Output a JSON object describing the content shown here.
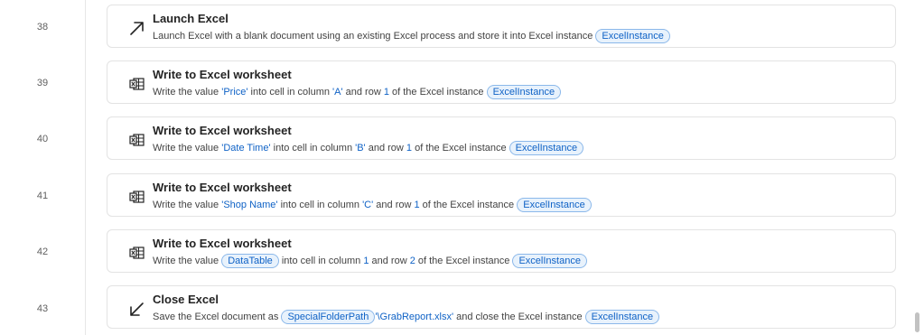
{
  "steps": [
    {
      "line": "38",
      "title": "Launch Excel",
      "icon": "launch-arrow-icon",
      "desc": [
        "Launch Excel with a blank document using an existing Excel process and store it into Excel instance ",
        "ExcelInstance"
      ]
    },
    {
      "line": "39",
      "title": "Write to Excel worksheet",
      "icon": "excel-worksheet-icon",
      "desc": [
        "Write the value ",
        "'Price'",
        " into cell in column ",
        "'A'",
        " and row ",
        "1",
        " of the Excel instance ",
        "ExcelInstance"
      ]
    },
    {
      "line": "40",
      "title": "Write to Excel worksheet",
      "icon": "excel-worksheet-icon",
      "desc": [
        "Write the value ",
        "'Date Time'",
        " into cell in column ",
        "'B'",
        " and row ",
        "1",
        " of the Excel instance ",
        "ExcelInstance"
      ]
    },
    {
      "line": "41",
      "title": "Write to Excel worksheet",
      "icon": "excel-worksheet-icon",
      "desc": [
        "Write the value ",
        "'Shop Name'",
        " into cell in column ",
        "'C'",
        " and row ",
        "1",
        " of the Excel instance ",
        "ExcelInstance"
      ]
    },
    {
      "line": "42",
      "title": "Write to Excel worksheet",
      "icon": "excel-worksheet-icon",
      "desc": [
        "Write the value ",
        "DataTable",
        " into cell in column ",
        "1",
        " and row ",
        "2",
        " of the Excel instance ",
        "ExcelInstance"
      ]
    },
    {
      "line": "43",
      "title": "Close Excel",
      "icon": "close-arrow-icon",
      "desc": [
        "Save the Excel document as ",
        "SpecialFolderPath",
        "'\\GrabReport.xlsx'",
        " and close the Excel instance ",
        "ExcelInstance"
      ]
    }
  ],
  "colors": {
    "accent": "#0f62c6",
    "pill_bg": "#e8f2fc",
    "pill_border": "#8bb8ea",
    "card_border": "#e3e3e3",
    "title": "#242424",
    "desc": "#424242",
    "line_number": "#5f5f5f"
  }
}
